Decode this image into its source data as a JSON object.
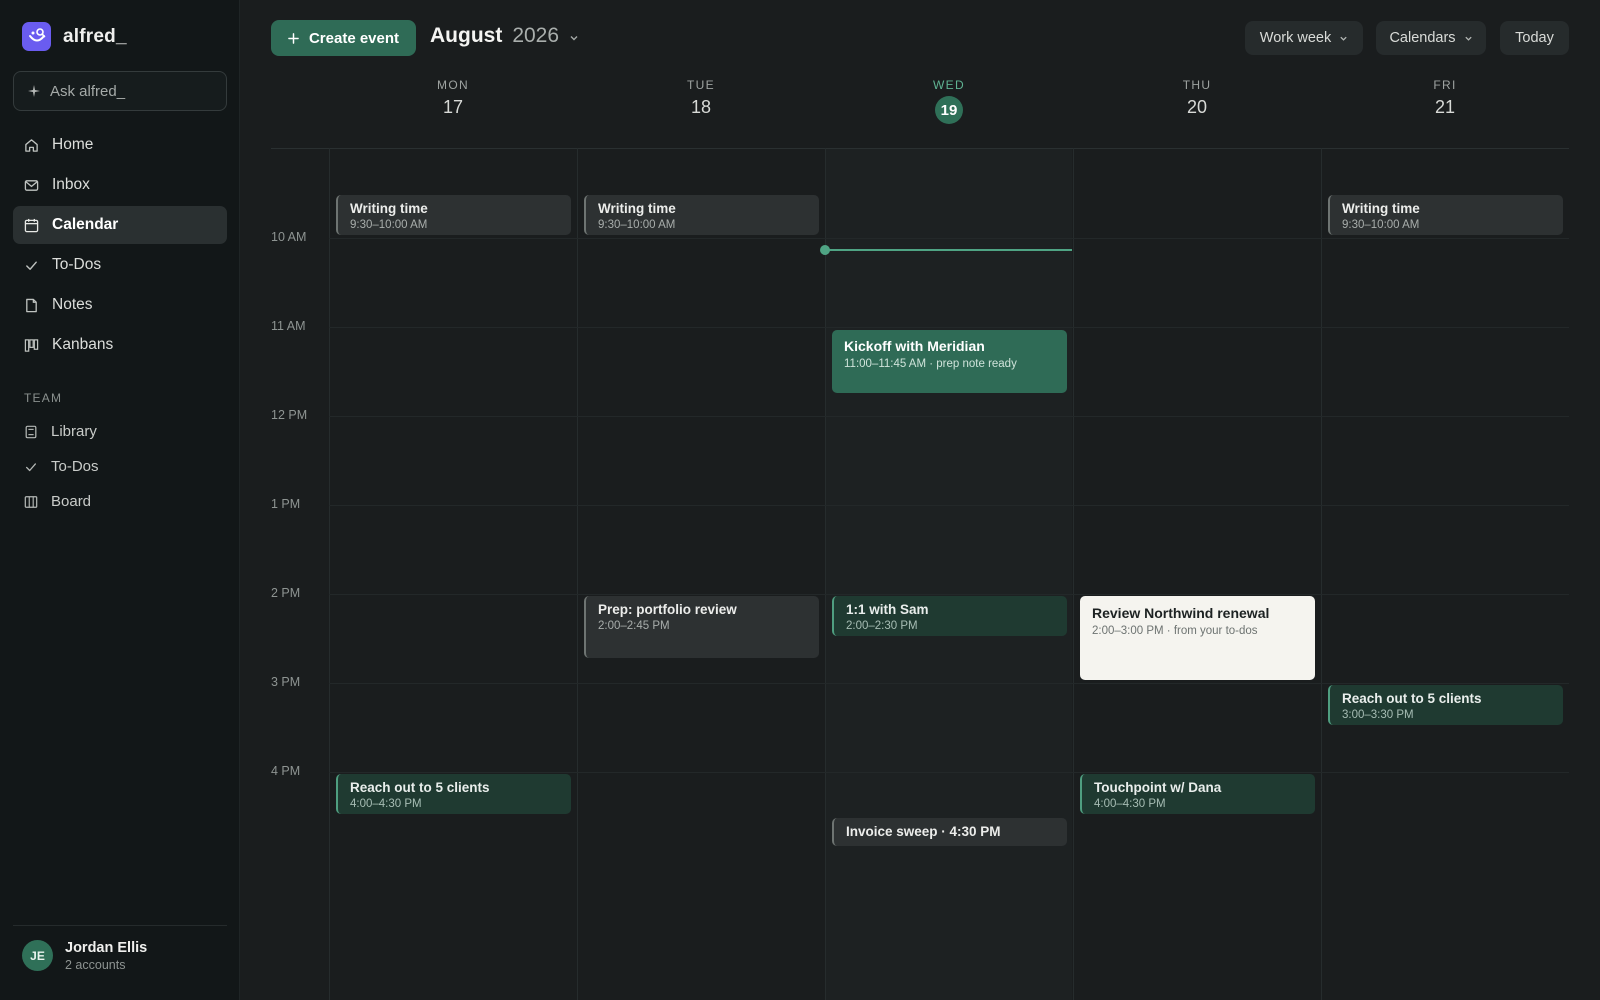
{
  "sidebar": {
    "brand": "alfred_",
    "ask_placeholder": "Ask alfred_",
    "nav": [
      {
        "label": "Home",
        "icon": "home-icon"
      },
      {
        "label": "Inbox",
        "icon": "mail-icon"
      },
      {
        "label": "Calendar",
        "icon": "calendar-icon"
      },
      {
        "label": "To-Dos",
        "icon": "check-icon"
      },
      {
        "label": "Notes",
        "icon": "note-icon"
      },
      {
        "label": "Kanbans",
        "icon": "kanban-icon"
      }
    ],
    "active": "Calendar",
    "team_label": "TEAM",
    "team": [
      {
        "label": "Library",
        "icon": "book-icon"
      },
      {
        "label": "To-Dos",
        "icon": "check-icon"
      },
      {
        "label": "Board",
        "icon": "board-icon"
      }
    ],
    "user": {
      "initials": "JE",
      "name": "Jordan Ellis",
      "sub": "2 accounts"
    }
  },
  "toolbar": {
    "create_label": "Create event",
    "month": "August",
    "year": "2026",
    "view_label": "Work week",
    "calendars_label": "Calendars",
    "today_label": "Today"
  },
  "days": [
    {
      "dow": "MON",
      "dom": "17"
    },
    {
      "dow": "TUE",
      "dom": "18"
    },
    {
      "dow": "WED",
      "dom": "19"
    },
    {
      "dow": "THU",
      "dom": "20"
    },
    {
      "dow": "FRI",
      "dom": "21"
    }
  ],
  "today_index": 2,
  "hours": [
    "10 AM",
    "11 AM",
    "12 PM",
    "1 PM",
    "2 PM",
    "3 PM",
    "4 PM"
  ],
  "events": [
    {
      "title": "Writing time",
      "time": "9:30–10:00 AM"
    },
    {
      "title": "Writing time",
      "time": "9:30–10:00 AM"
    },
    {
      "title": "Writing time",
      "time": "9:30–10:00 AM"
    },
    {
      "title": "Kickoff with Meridian",
      "time": "11:00–11:45 AM · prep note ready"
    },
    {
      "title": "Prep: portfolio review",
      "time": "2:00–2:45 PM"
    },
    {
      "title": "1:1 with Sam",
      "time": "2:00–2:30 PM"
    },
    {
      "title": "Review Northwind renewal",
      "time": "2:00–3:00 PM · from your to-dos"
    },
    {
      "title": "Reach out to 5 clients",
      "time": "3:00–3:30 PM"
    },
    {
      "title": "Reach out to 5 clients",
      "time": "4:00–4:30 PM"
    },
    {
      "title": "Touchpoint w/ Dana",
      "time": "4:00–4:30 PM"
    },
    {
      "title": "Invoice sweep · 4:30 PM",
      "time": ""
    }
  ],
  "colors": {
    "accent": "#2f6b56",
    "brand": "#6a5cf0",
    "now": "#4fa484"
  }
}
